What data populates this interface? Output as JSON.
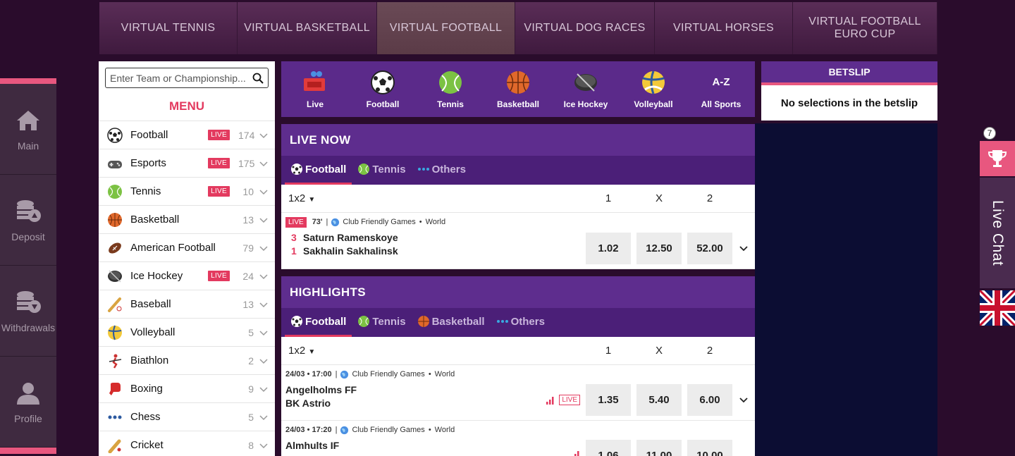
{
  "topnav": [
    {
      "label": "VIRTUAL TENNIS",
      "width": 0
    },
    {
      "label": "VIRTUAL BASKETBALL"
    },
    {
      "label": "VIRTUAL FOOTBALL"
    },
    {
      "label": "VIRTUAL DOG RACES"
    },
    {
      "label": "VIRTUAL HORSES"
    },
    {
      "label": "VIRTUAL FOOTBALL EURO CUP"
    }
  ],
  "rail": [
    {
      "label": "Main",
      "icon": "home-icon"
    },
    {
      "label": "Deposit",
      "icon": "coins-up-icon"
    },
    {
      "label": "Withdrawals",
      "icon": "coins-down-icon"
    },
    {
      "label": "Profile",
      "icon": "user-icon"
    }
  ],
  "search": {
    "placeholder": "Enter Team or Championship..."
  },
  "menu": {
    "title": "MENU",
    "items": [
      {
        "name": "Football",
        "live": "LIVE",
        "count": "174"
      },
      {
        "name": "Esports",
        "live": "LIVE",
        "count": "175"
      },
      {
        "name": "Tennis",
        "live": "LIVE",
        "count": "10"
      },
      {
        "name": "Basketball",
        "live": "",
        "count": "13"
      },
      {
        "name": "American Football",
        "live": "",
        "count": "79"
      },
      {
        "name": "Ice Hockey",
        "live": "LIVE",
        "count": "24"
      },
      {
        "name": "Baseball",
        "live": "",
        "count": "13"
      },
      {
        "name": "Volleyball",
        "live": "",
        "count": "5"
      },
      {
        "name": "Biathlon",
        "live": "",
        "count": "2"
      },
      {
        "name": "Boxing",
        "live": "",
        "count": "9"
      },
      {
        "name": "Chess",
        "live": "",
        "count": "5"
      },
      {
        "name": "Cricket",
        "live": "",
        "count": "8"
      }
    ]
  },
  "sportsbar": [
    {
      "label": "Live"
    },
    {
      "label": "Football"
    },
    {
      "label": "Tennis"
    },
    {
      "label": "Basketball"
    },
    {
      "label": "Ice Hockey"
    },
    {
      "label": "Volleyball"
    },
    {
      "label": "All Sports",
      "icon_text": "A-Z"
    }
  ],
  "live_now": {
    "title": "LIVE NOW",
    "tabs": [
      "Football",
      "Tennis",
      "Others"
    ],
    "market": "1x2",
    "cols": [
      "1",
      "X",
      "2"
    ],
    "event": {
      "live": "LIVE",
      "minute": "73'",
      "competition": "Club Friendly Games",
      "region": "World",
      "home": "Saturn Ramenskoye",
      "away": "Sakhalin Sakhalinsk",
      "home_score": "3",
      "away_score": "1",
      "odds": [
        "1.02",
        "12.50",
        "52.00"
      ]
    }
  },
  "highlights": {
    "title": "HIGHLIGHTS",
    "tabs": [
      "Football",
      "Tennis",
      "Basketball",
      "Others"
    ],
    "market": "1x2",
    "cols": [
      "1",
      "X",
      "2"
    ],
    "events": [
      {
        "time": "24/03 • 17:00",
        "competition": "Club Friendly Games",
        "region": "World",
        "home": "Angelholms FF",
        "away": "BK Astrio",
        "live": "LIVE",
        "odds": [
          "1.35",
          "5.40",
          "6.00"
        ]
      },
      {
        "time": "24/03 • 17:20",
        "competition": "Club Friendly Games",
        "region": "World",
        "home": "Almhults IF",
        "away": "",
        "live": "",
        "odds": [
          "1.06",
          "11.00",
          "10.00"
        ]
      }
    ]
  },
  "betslip": {
    "title": "BETSLIP",
    "empty": "No selections in the betslip"
  },
  "widgets": {
    "badge": "7",
    "live_chat": "Live Chat"
  },
  "colors": {
    "accent": "#e33a5f",
    "purple": "#5e2d8e",
    "dark": "#0c0d33"
  }
}
